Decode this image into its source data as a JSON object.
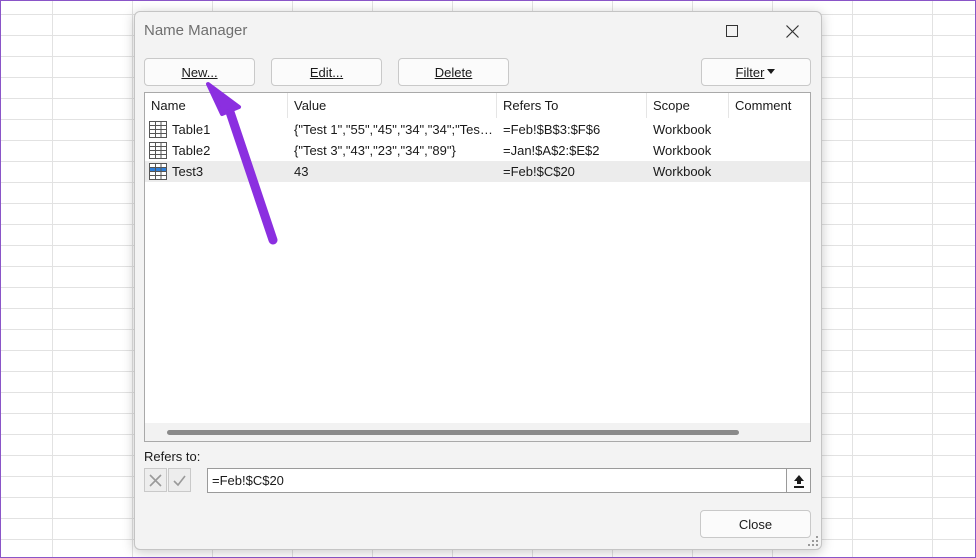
{
  "dialog": {
    "title": "Name Manager",
    "buttons": {
      "new": "New...",
      "edit": "Edit...",
      "delete": "Delete",
      "filter": "Filter",
      "close": "Close"
    },
    "columns": [
      "Name",
      "Value",
      "Refers To",
      "Scope",
      "Comment"
    ],
    "rows": [
      {
        "name": "Table1",
        "value": "{\"Test 1\",\"55\",\"45\",\"34\",\"34\";\"Test...",
        "refers_to": "=Feb!$B$3:$F$6",
        "scope": "Workbook",
        "comment": "",
        "icon": "table-icon"
      },
      {
        "name": "Table2",
        "value": "{\"Test 3\",\"43\",\"23\",\"34\",\"89\"}",
        "refers_to": "=Jan!$A$2:$E$2",
        "scope": "Workbook",
        "comment": "",
        "icon": "table-icon"
      },
      {
        "name": "Test3",
        "value": "43",
        "refers_to": "=Feb!$C$20",
        "scope": "Workbook",
        "comment": "",
        "icon": "named-range-icon"
      }
    ],
    "refers_to_label": "Refers to:",
    "refers_to_value": "=Feb!$C$20"
  },
  "colors": {
    "annotation_arrow": "#8b2fe0",
    "accent_blue": "#2f7fd8"
  }
}
